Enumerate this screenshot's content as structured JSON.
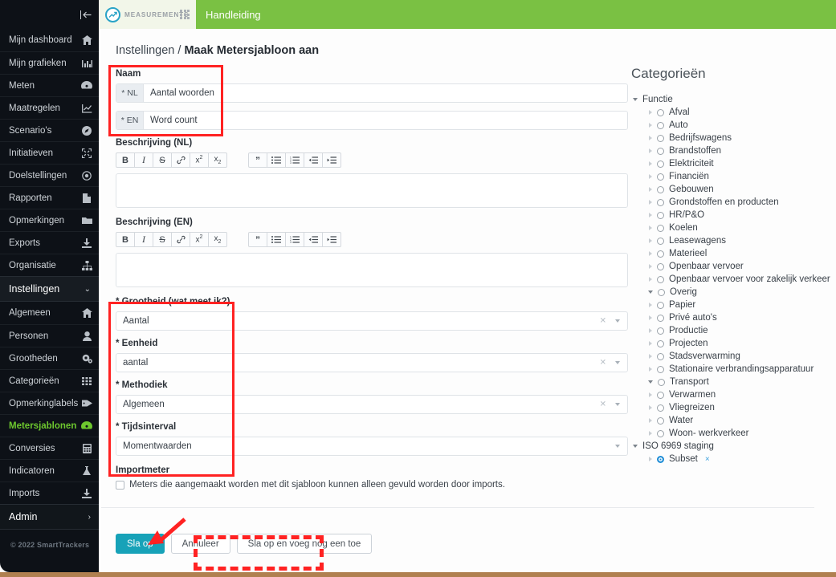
{
  "window": {
    "title": "Maak Metersjabloon aan"
  },
  "topbar": {
    "brand": "MEASUREMENTS",
    "brand_icon": "chart-circle-logo-icon",
    "apps_icon": "grid-dots-icon",
    "handleiding": "Handleiding",
    "green": "#7ac143"
  },
  "sidebar": {
    "collapse_icon": "collapse-left-icon",
    "items": [
      {
        "label": "Mijn dashboard",
        "icon": "home-icon"
      },
      {
        "label": "Mijn grafieken",
        "icon": "bar-chart-icon"
      },
      {
        "label": "Meten",
        "icon": "gauge-icon"
      },
      {
        "label": "Maatregelen",
        "icon": "line-chart-icon"
      },
      {
        "label": "Scenario's",
        "icon": "compass-icon"
      },
      {
        "label": "Initiatieven",
        "icon": "expand-arrows-icon"
      },
      {
        "label": "Doelstellingen",
        "icon": "target-icon"
      },
      {
        "label": "Rapporten",
        "icon": "file-icon"
      },
      {
        "label": "Opmerkingen",
        "icon": "folder-icon"
      },
      {
        "label": "Exports",
        "icon": "download-icon"
      },
      {
        "label": "Organisatie",
        "icon": "sitemap-icon"
      }
    ],
    "group_settings": {
      "label": "Instellingen",
      "icon": "chevron-down-icon"
    },
    "settings_items": [
      {
        "label": "Algemeen",
        "icon": "home-icon",
        "active": false
      },
      {
        "label": "Personen",
        "icon": "user-icon",
        "active": false
      },
      {
        "label": "Grootheden",
        "icon": "gears-icon",
        "active": false
      },
      {
        "label": "Categorieën",
        "icon": "grid-icon",
        "active": false
      },
      {
        "label": "Opmerkinglabels",
        "icon": "tag-icon",
        "active": false
      },
      {
        "label": "Metersjablonen",
        "icon": "gauge-icon",
        "active": true
      },
      {
        "label": "Conversies",
        "icon": "calculator-icon",
        "active": false
      },
      {
        "label": "Indicatoren",
        "icon": "flask-icon",
        "active": false
      },
      {
        "label": "Imports",
        "icon": "download-icon",
        "active": false
      }
    ],
    "group_admin": {
      "label": "Admin",
      "icon": "chevron-right-icon"
    },
    "copyright": "© 2022 SmartTrackers",
    "active_color": "#6dc72e"
  },
  "breadcrumb": {
    "parent": "Instellingen",
    "sep": " / ",
    "current": "Maak Metersjabloon aan"
  },
  "form": {
    "naam_label": "Naam",
    "naam_rows": [
      {
        "tag": "* NL",
        "value": "Aantal woorden",
        "placeholder": ""
      },
      {
        "tag": "* EN",
        "value": "Word count",
        "placeholder": ""
      }
    ],
    "desc_nl_label": "Beschrijving (NL)",
    "desc_nl_value": "",
    "desc_en_label": "Beschrijving (EN)",
    "desc_en_value": "",
    "rte_group_1": [
      {
        "label": "B",
        "icon": "bold-icon"
      },
      {
        "label": "I",
        "icon": "italic-icon"
      },
      {
        "label": "S",
        "icon": "strikethrough-icon"
      },
      {
        "label": "",
        "icon": "link-icon"
      },
      {
        "label": "x2",
        "icon": "superscript-icon"
      },
      {
        "label": "x2",
        "icon": "subscript-icon"
      }
    ],
    "rte_group_2": [
      {
        "label": "",
        "icon": "blockquote-icon"
      },
      {
        "label": "",
        "icon": "bullet-list-icon"
      },
      {
        "label": "",
        "icon": "ordered-list-icon"
      },
      {
        "label": "",
        "icon": "outdent-icon"
      },
      {
        "label": "",
        "icon": "indent-icon"
      }
    ],
    "selects": [
      {
        "label": "* Grootheid (wat meet ik?)",
        "value": "Aantal",
        "clearable": true
      },
      {
        "label": "* Eenheid",
        "value": "aantal",
        "clearable": true
      },
      {
        "label": "* Methodiek",
        "value": "Algemeen",
        "clearable": true
      },
      {
        "label": "* Tijdsinterval",
        "value": "Momentwaarden",
        "clearable": false
      }
    ],
    "importmeter_label": "Importmeter",
    "importmeter_checkbox": {
      "checked": false,
      "text": "Meters die aangemaakt worden met dit sjabloon kunnen alleen gevuld worden door imports."
    },
    "buttons": [
      {
        "label": "Sla op",
        "style": "primary"
      },
      {
        "label": "Annuleer",
        "style": "default"
      },
      {
        "label": "Sla op en voeg nog een toe",
        "style": "default"
      }
    ],
    "primary_color": "#17a2b8"
  },
  "categories": {
    "title": "Categorieën",
    "groups": [
      {
        "label": "Functie",
        "items": [
          {
            "label": "Afval",
            "selected": false
          },
          {
            "label": "Auto",
            "selected": false
          },
          {
            "label": "Bedrijfswagens",
            "selected": false
          },
          {
            "label": "Brandstoffen",
            "selected": false
          },
          {
            "label": "Elektriciteit",
            "selected": false
          },
          {
            "label": "Financiën",
            "selected": false
          },
          {
            "label": "Gebouwen",
            "selected": false
          },
          {
            "label": "Grondstoffen en producten",
            "selected": false
          },
          {
            "label": "HR/P&O",
            "selected": false
          },
          {
            "label": "Koelen",
            "selected": false
          },
          {
            "label": "Leasewagens",
            "selected": false
          },
          {
            "label": "Materieel",
            "selected": false
          },
          {
            "label": "Openbaar vervoer",
            "selected": false
          },
          {
            "label": "Openbaar vervoer voor zakelijk verkeer",
            "selected": false
          },
          {
            "label": "Overig",
            "selected": false,
            "expandable": true
          },
          {
            "label": "Papier",
            "selected": false
          },
          {
            "label": "Privé auto's",
            "selected": false
          },
          {
            "label": "Productie",
            "selected": false
          },
          {
            "label": "Projecten",
            "selected": false
          },
          {
            "label": "Stadsverwarming",
            "selected": false
          },
          {
            "label": "Stationaire verbrandingsapparatuur",
            "selected": false
          },
          {
            "label": "Transport",
            "selected": false,
            "expandable": true
          },
          {
            "label": "Verwarmen",
            "selected": false
          },
          {
            "label": "Vliegreizen",
            "selected": false
          },
          {
            "label": "Water",
            "selected": false
          },
          {
            "label": "Woon- werkverkeer",
            "selected": false
          }
        ]
      },
      {
        "label": "ISO 6969 staging",
        "items": [
          {
            "label": "Subset",
            "selected": true,
            "clear": "×"
          }
        ]
      }
    ],
    "selected_color": "#1f8dd6",
    "link_color": "#3ba0dd"
  },
  "annotations": {
    "color": "#ff2222",
    "highlight_naam": "solid-rect-around-naam-fields",
    "highlight_required": "solid-rect-around-required-selects",
    "dashed_box": "dashed-rect-around-save-and-add-another",
    "arrow": "arrow-pointing-to-save-button"
  }
}
